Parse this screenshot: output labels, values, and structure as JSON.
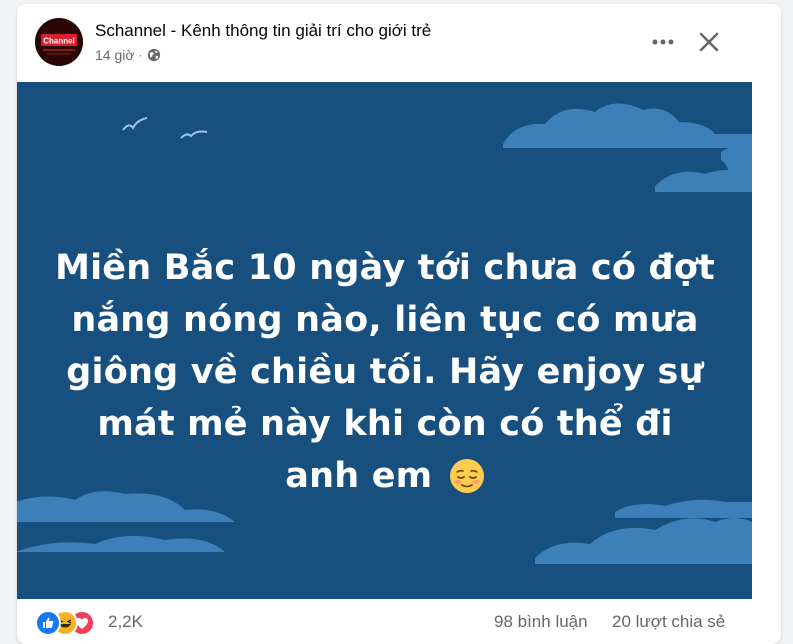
{
  "post": {
    "page_name": "Schannel - Kênh thông tin giải trí cho giới trẻ",
    "time": "14 giờ",
    "separator": "·",
    "privacy_icon": "globe-icon",
    "avatar_text": "Channel",
    "more_icon": "more-horizontal-icon",
    "close_icon": "close-icon",
    "body_text": "Miền Bắc 10 ngày tới chưa có đợt nắng nóng nào, liên tục có mưa giông về chiều tối. Hãy enjoy sự mát mẻ này khi còn có thể đi anh em",
    "body_emoji": "relieved-face-emoji"
  },
  "colors": {
    "image_background": "#17507f",
    "cloud": "#3d7fb8",
    "like": "#1877f2",
    "haha": "#f7b125",
    "love": "#f33e58"
  },
  "footer": {
    "reaction_icons": [
      "like-icon",
      "haha-icon",
      "love-icon"
    ],
    "reaction_count": "2,2K",
    "comments": "98 bình luận",
    "shares": "20 lượt chia sẻ"
  }
}
